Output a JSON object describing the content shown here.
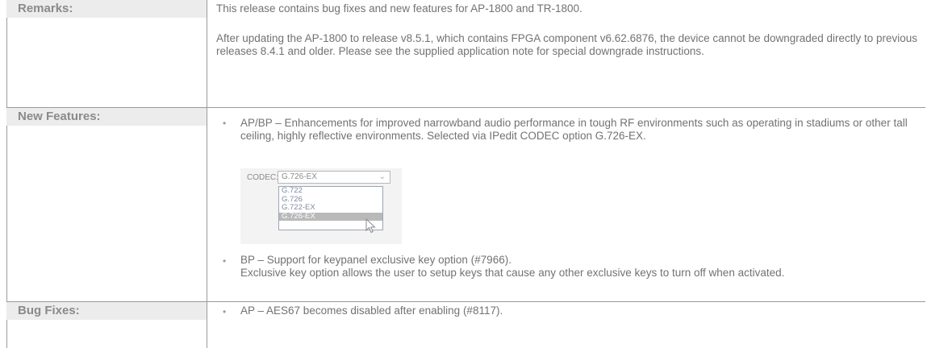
{
  "remarks": {
    "label": "Remarks:",
    "p1": "This release contains bug fixes and new features for AP-1800 and TR-1800.",
    "p2": "After updating the AP-1800 to release v8.5.1, which contains FPGA component v6.62.6876, the device cannot be downgraded directly to previous releases 8.4.1 and older.  Please see the supplied application note for special downgrade instructions."
  },
  "new_features": {
    "label": "New Features:",
    "item1": "AP/BP – Enhancements for improved narrowband audio performance in tough RF environments such as operating in stadiums or other tall ceiling, highly reflective environments.  Selected via IPedit CODEC option G.726-EX.",
    "codec": {
      "label": "CODEC:",
      "selected": "G.726-EX",
      "options": [
        "G.722",
        "G.726",
        "G.722-EX",
        "G.726-EX"
      ]
    },
    "item2_line1": "BP – Support for keypanel exclusive key option (#7966).",
    "item2_line2": "Exclusive key option allows the user to setup keys that cause any other exclusive keys to turn off when activated."
  },
  "bug_fixes": {
    "label": "Bug Fixes:",
    "item1": "AP – AES67 becomes disabled after enabling (#8117)."
  },
  "bullet_glyph": "•",
  "icons": {
    "chevron": "chevron-down-icon",
    "cursor": "mouse-pointer-icon"
  }
}
